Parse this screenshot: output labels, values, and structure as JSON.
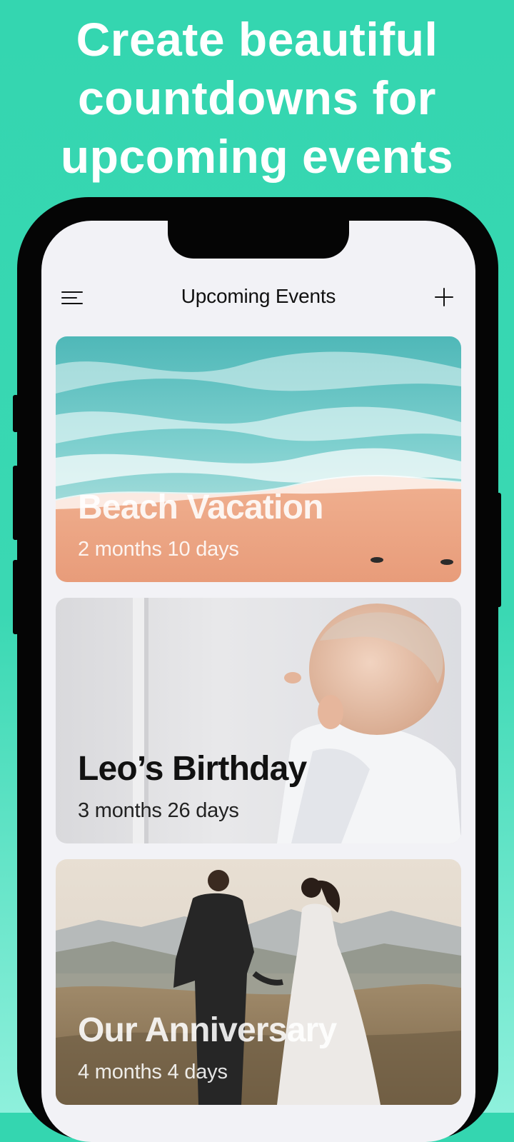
{
  "promo": {
    "headline_line1": "Create beautiful",
    "headline_line2": "countdowns for",
    "headline_line3": "upcoming events"
  },
  "navbar": {
    "menu_icon": "hamburger-menu-icon",
    "title": "Upcoming Events",
    "add_icon": "plus-icon"
  },
  "events": [
    {
      "title": "Beach Vacation",
      "countdown": "2 months 10 days"
    },
    {
      "title": "Leo’s Birthday",
      "countdown": "3 months 26 days"
    },
    {
      "title": "Our Anniversary",
      "countdown": "4 months 4 days"
    }
  ],
  "colors": {
    "background_top": "#34d6b0",
    "background_bottom": "#8ef0dc",
    "phone_frame": "#050505",
    "screen_bg": "#f2f2f6"
  }
}
